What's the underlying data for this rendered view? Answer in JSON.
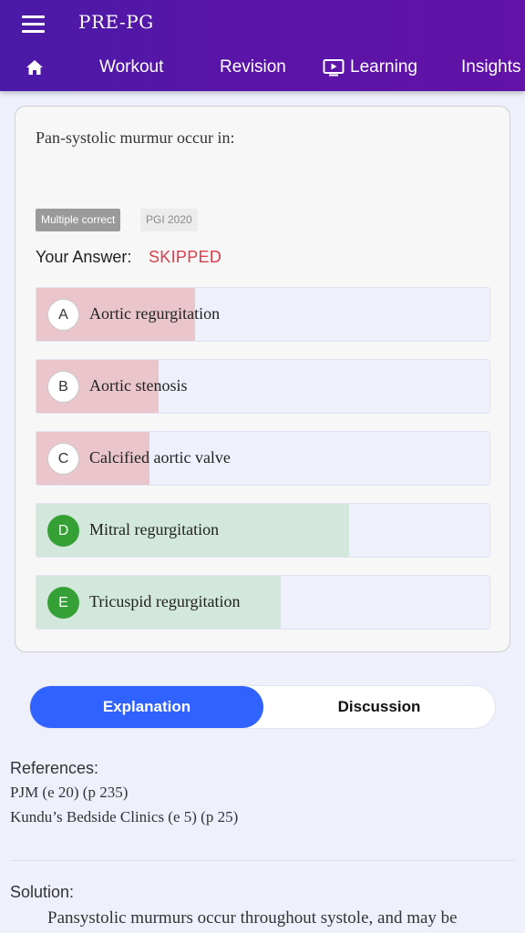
{
  "header": {
    "title": "PRE-PG",
    "nav": [
      {
        "label": "Workout"
      },
      {
        "label": "Revision"
      },
      {
        "label": "Learning"
      },
      {
        "label": "Insights"
      }
    ]
  },
  "question": {
    "text": "Pan-systolic murmur occur in:",
    "tags": [
      "Multiple correct",
      "PGI 2020"
    ],
    "answer_label": "Your Answer:",
    "answer_value": "SKIPPED",
    "options": [
      {
        "letter": "A",
        "text": "Aortic regurgitation",
        "status": "wrong",
        "fill": 0.35
      },
      {
        "letter": "B",
        "text": "Aortic stenosis",
        "status": "wrong",
        "fill": 0.27
      },
      {
        "letter": "C",
        "text": "Calcified aortic valve",
        "status": "wrong",
        "fill": 0.25
      },
      {
        "letter": "D",
        "text": "Mitral regurgitation",
        "status": "correct",
        "fill": 0.69
      },
      {
        "letter": "E",
        "text": "Tricuspid regurgitation",
        "status": "correct",
        "fill": 0.54
      }
    ]
  },
  "tabs": {
    "explanation": "Explanation",
    "discussion": "Discussion"
  },
  "references": {
    "heading": "References:",
    "items": [
      "PJM (e 20) (p 235)",
      "Kundu’s Bedside Clinics (e 5) (p 25)"
    ]
  },
  "solution": {
    "heading": "Solution:",
    "text": "Pansystolic murmurs occur throughout systole, and may be"
  },
  "colors": {
    "header_start": "#4a1aa6",
    "header_end": "#6212a6",
    "wrong_fill": "#eac6cc",
    "correct_fill": "#d3e8dc",
    "correct_circle": "#35a035",
    "skipped_text": "#d93f4c",
    "tab_active": "#2f62ff"
  }
}
